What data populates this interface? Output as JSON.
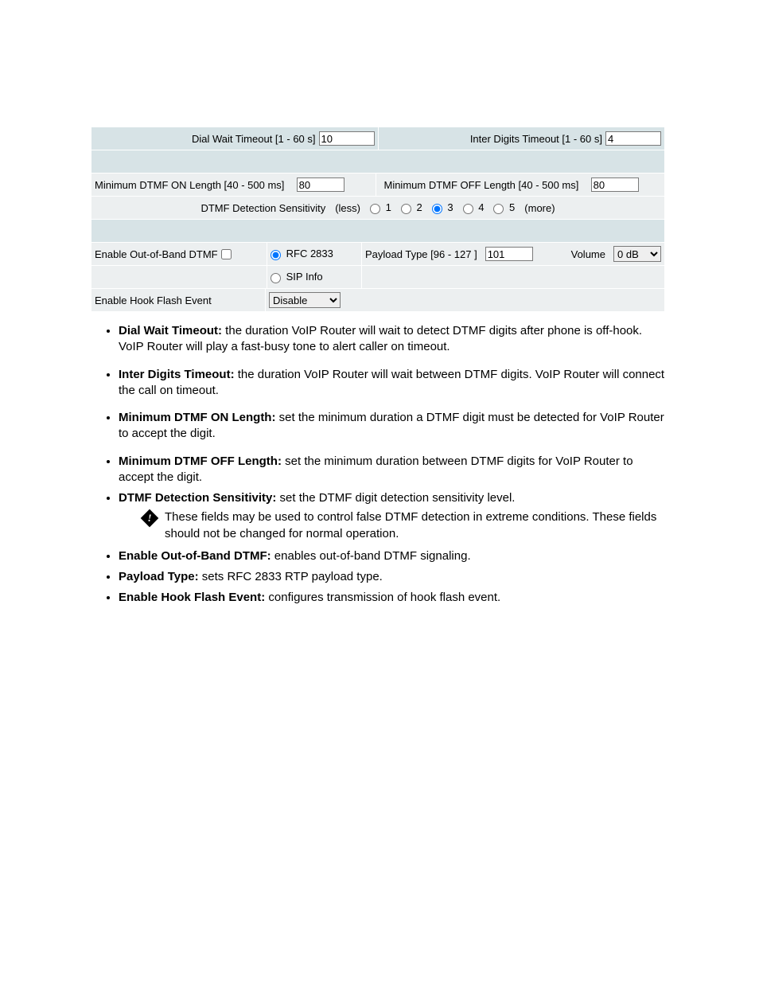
{
  "form": {
    "dial_wait_label": "Dial Wait Timeout [1 - 60 s]",
    "dial_wait_value": "10",
    "inter_digits_label": "Inter Digits Timeout [1 - 60 s]",
    "inter_digits_value": "4",
    "dtmf_on_label": "Minimum DTMF ON Length [40 - 500 ms]",
    "dtmf_on_value": "80",
    "dtmf_off_label": "Minimum DTMF OFF Length [40 - 500 ms]",
    "dtmf_off_value": "80",
    "sensitivity_label_left": "DTMF Detection Sensitivity",
    "sensitivity_less": "(less)",
    "sensitivity_more": "(more)",
    "sensitivity_options": [
      "1",
      "2",
      "3",
      "4",
      "5"
    ],
    "sensitivity_selected": "3",
    "oob_label": "Enable Out-of-Band DTMF",
    "oob_checked": false,
    "oob_mode_options": [
      "RFC 2833",
      "SIP Info"
    ],
    "oob_mode_selected": "RFC 2833",
    "payload_label": "Payload Type [96 - 127 ]",
    "payload_value": "101",
    "volume_label": "Volume",
    "volume_value": "0 dB",
    "hookflash_label": "Enable Hook Flash Event",
    "hookflash_value": "Disable"
  },
  "bullets": [
    {
      "term": "Dial Wait Timeout:",
      "text": " the duration VoIP Router will wait to detect DTMF digits after phone is off-hook. VoIP Router will play a fast-busy tone to alert caller on timeout."
    },
    {
      "term": "Inter Digits Timeout:",
      "text": " the duration VoIP Router will wait between DTMF digits. VoIP Router will connect the call on timeout."
    },
    {
      "term": "Minimum DTMF ON Length:",
      "text": " set the minimum duration a DTMF digit must be detected for VoIP Router to accept the digit."
    },
    {
      "term": "Minimum DTMF OFF Length:",
      "text": " set the minimum duration between DTMF digits for VoIP Router to accept the digit."
    },
    {
      "term": "DTMF Detection Sensitivity:",
      "text": " set the DTMF digit detection sensitivity level."
    }
  ],
  "note": "These fields may be used to control false DTMF detection in extreme conditions. These fields should not be changed for normal operation.",
  "bullets2": [
    {
      "term": "Enable Out-of-Band DTMF:",
      "text": " enables out-of-band DTMF signaling."
    },
    {
      "term": "Payload Type:",
      "text": " sets RFC 2833 RTP payload type."
    },
    {
      "term": "Enable Hook Flash Event:",
      "text": " configures transmission of hook flash event."
    }
  ]
}
